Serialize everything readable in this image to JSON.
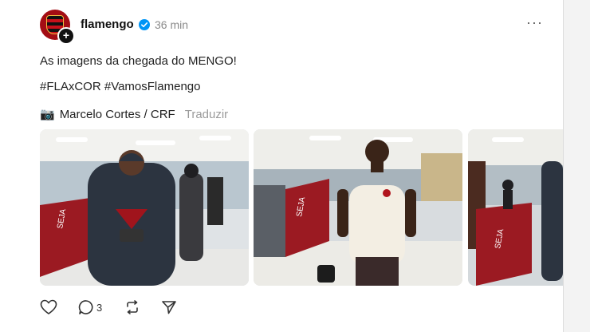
{
  "post": {
    "username": "flamengo",
    "time": "36 min",
    "text": "As imagens da chegada do MENGO!",
    "hashtags": "#FLAxCOR #VamosFlamengo",
    "photo_credit": "Marcelo Cortes / CRF",
    "translate_label": "Traduzir",
    "more_label": "···"
  },
  "photos": [
    {
      "alt": "Player in dark hooded jacket walking"
    },
    {
      "alt": "Player in white Flamengo shirt carrying bag"
    },
    {
      "alt": "Stadium corridor with red banners"
    }
  ],
  "actions": {
    "reply_count": "3"
  },
  "icons": {
    "verified": "verified-check-icon",
    "camera": "camera-icon",
    "like": "heart-icon",
    "reply": "comment-icon",
    "repost": "repost-icon",
    "share": "send-icon"
  },
  "colors": {
    "brand_red": "#a30d14",
    "verified_blue": "#0095f6",
    "muted_text": "#8a8a8a"
  }
}
